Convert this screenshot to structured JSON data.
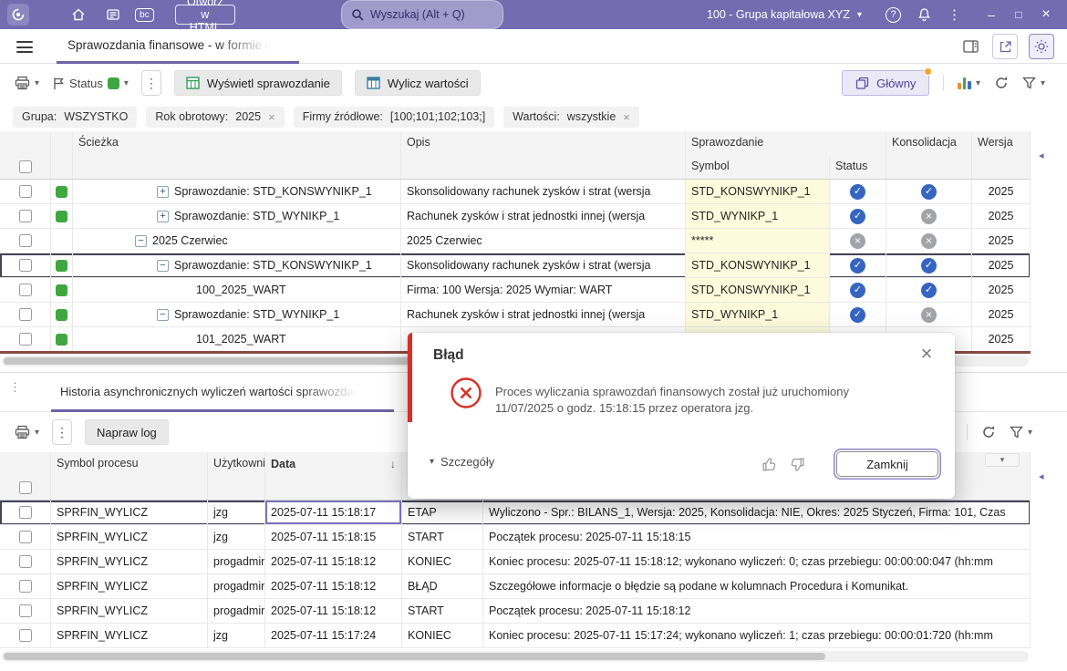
{
  "icons": {
    "chevron_down": "▾",
    "close": "×",
    "kebab": "⋮",
    "sort_desc": "↓",
    "collapse_left": "◂",
    "minimize": "–",
    "maximize": "□"
  },
  "topbar": {
    "bc_badge": "bc",
    "open_html_button": "Otwórz w HTML",
    "search_placeholder": "Wyszukaj (Alt + Q)",
    "company_selector": "100 - Grupa kapitałowa XYZ",
    "help_glyph": "?"
  },
  "tabbar": {
    "active_tab": "Sprawozdania finansowe -  w formie d"
  },
  "toolbar": {
    "status_label": "Status",
    "show_report_button": "Wyświetl sprawozdanie",
    "calc_values_button": "Wylicz wartości",
    "main_button": "Główny"
  },
  "filters": [
    {
      "label": "Grupa:",
      "value": "WSZYSTKO"
    },
    {
      "label": "Rok obrotowy:",
      "value": "2025"
    },
    {
      "label": "Firmy źródłowe:",
      "value": "[100;101;102;103;]"
    },
    {
      "label": "Wartości:",
      "value": "wszystkie"
    }
  ],
  "main_grid": {
    "col_path": "Ścieżka",
    "col_desc": "Opis",
    "col_report": "Sprawozdanie",
    "col_symbol": "Symbol",
    "col_status": "Status",
    "col_consolidation": "Konsolidacja",
    "col_version": "Wersja",
    "rows": [
      {
        "green": true,
        "expander": "plus",
        "level": 1,
        "path": "Sprawozdanie: STD_KONSWYNIKP_1",
        "desc": "Skonsolidowany rachunek zysków i strat (wersja",
        "symbol": "STD_KONSWYNIKP_1",
        "status": "check",
        "consolidation": "check",
        "version": "2025",
        "selected": false
      },
      {
        "green": true,
        "expander": "plus",
        "level": 1,
        "path": "Sprawozdanie: STD_WYNIKP_1",
        "desc": "Rachunek zysków i strat jednostki innej (wersja",
        "symbol": "STD_WYNIKP_1",
        "status": "check",
        "consolidation": "x",
        "version": "2025",
        "selected": false
      },
      {
        "green": false,
        "expander": "minus",
        "level": 0,
        "path": "2025 Czerwiec",
        "desc": "2025 Czerwiec",
        "symbol": "*****",
        "status": "x",
        "consolidation": "x",
        "version": "2025",
        "selected": false
      },
      {
        "green": true,
        "expander": "minus",
        "level": 1,
        "path": "Sprawozdanie: STD_KONSWYNIKP_1",
        "desc": "Skonsolidowany rachunek zysków i strat (wersja",
        "symbol": "STD_KONSWYNIKP_1",
        "status": "check",
        "consolidation": "check",
        "version": "2025",
        "selected": true
      },
      {
        "green": true,
        "expander": "none",
        "level": 2,
        "path": "100_2025_WART",
        "desc": "Firma: 100 Wersja: 2025 Wymiar: WART",
        "symbol": "STD_KONSWYNIKP_1",
        "status": "check",
        "consolidation": "check",
        "version": "2025",
        "selected": false
      },
      {
        "green": true,
        "expander": "minus",
        "level": 1,
        "path": "Sprawozdanie: STD_WYNIKP_1",
        "desc": "Rachunek zysków i strat jednostki innej (wersja",
        "symbol": "STD_WYNIKP_1",
        "status": "check",
        "consolidation": "x",
        "version": "2025",
        "selected": false
      },
      {
        "green": true,
        "expander": "none",
        "level": 2,
        "path": "101_2025_WART",
        "desc": "",
        "symbol": "",
        "status": "none",
        "consolidation": "none",
        "version": "2025",
        "selected": false
      }
    ]
  },
  "dialog": {
    "title": "Błąd",
    "message": "Proces wyliczania sprawozdań finansowych został już uruchomiony 11/07/2025 o godz. 15:18:15 przez operatora jzg.",
    "details_label": "Szczegóły",
    "close_button": "Zamknij"
  },
  "bottom_panel": {
    "tab": "Historia asynchronicznych wyliczeń wartości sprawozdań",
    "fix_log_button": "Napraw log",
    "col_process": "Symbol procesu",
    "col_user": "Użytkownik",
    "col_date": "Data",
    "rows": [
      {
        "process": "SPRFIN_WYLICZ",
        "user": "jzg",
        "date": "2025-07-11 15:18:17",
        "stage": "ETAP",
        "message": "Wyliczono - Spr.: BILANS_1, Wersja: 2025, Konsolidacja: NIE, Okres: 2025 Styczeń, Firma: 101, Czas",
        "selected": true
      },
      {
        "process": "SPRFIN_WYLICZ",
        "user": "jzg",
        "date": "2025-07-11 15:18:15",
        "stage": "START",
        "message": "Początek procesu: 2025-07-11 15:18:15",
        "selected": false
      },
      {
        "process": "SPRFIN_WYLICZ",
        "user": "progadmin",
        "date": "2025-07-11 15:18:12",
        "stage": "KONIEC",
        "message": "Koniec procesu: 2025-07-11 15:18:12; wykonano wyliczeń: 0; czas przebiegu: 00:00:00:047 (hh:mm",
        "selected": false
      },
      {
        "process": "SPRFIN_WYLICZ",
        "user": "progadmin",
        "date": "2025-07-11 15:18:12",
        "stage": "BŁĄD",
        "message": "Szczegółowe informacje o błędzie są podane w kolumnach Procedura i Komunikat.",
        "selected": false
      },
      {
        "process": "SPRFIN_WYLICZ",
        "user": "progadmin",
        "date": "2025-07-11 15:18:12",
        "stage": "START",
        "message": "Początek procesu: 2025-07-11 15:18:12",
        "selected": false
      },
      {
        "process": "SPRFIN_WYLICZ",
        "user": "jzg",
        "date": "2025-07-11 15:17:24",
        "stage": "KONIEC",
        "message": "Koniec procesu: 2025-07-11 15:17:24; wykonano wyliczeń: 1; czas przebiegu: 00:00:01:720 (hh:mm",
        "selected": false
      }
    ]
  },
  "colors": {
    "topbar_purple": "#746CB1",
    "accent_purple": "#6C63A8",
    "yellow_cell": "#FDFBDC",
    "check_blue": "#3565C1",
    "x_gray": "#A2A4AA",
    "green_status": "#3FA73F",
    "error_red": "#D93025"
  }
}
